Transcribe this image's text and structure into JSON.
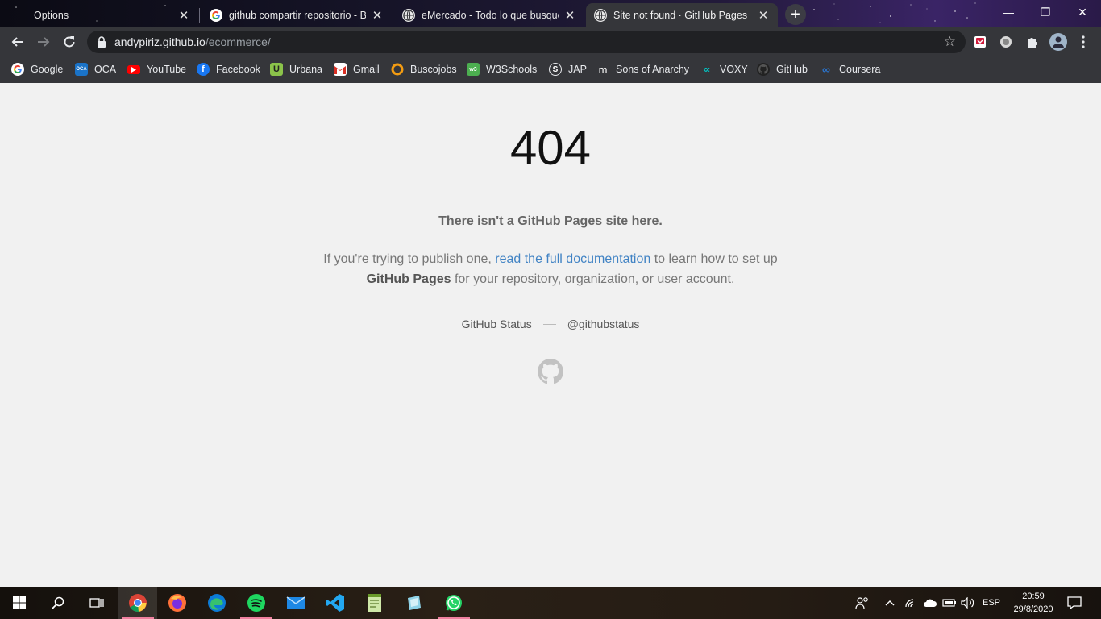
{
  "tabs": [
    {
      "title": "Options",
      "favicon": "blank-icon",
      "active": false
    },
    {
      "title": "github compartir repositorio - Bu",
      "favicon": "google-icon",
      "active": false
    },
    {
      "title": "eMercado - Todo lo que busques",
      "favicon": "globe-icon",
      "active": false
    },
    {
      "title": "Site not found · GitHub Pages",
      "favicon": "globe-icon",
      "active": true
    }
  ],
  "window_controls": {
    "minimize": "—",
    "restore": "❐",
    "close": "✕"
  },
  "toolbar": {
    "url_host": "andypiriz.github.io",
    "url_path": "/ecommerce/"
  },
  "bookmarks": [
    {
      "label": "Google",
      "icon": "google-icon"
    },
    {
      "label": "OCA",
      "icon": "oca-icon"
    },
    {
      "label": "YouTube",
      "icon": "youtube-icon"
    },
    {
      "label": "Facebook",
      "icon": "facebook-icon"
    },
    {
      "label": "Urbana",
      "icon": "urbana-icon"
    },
    {
      "label": "Gmail",
      "icon": "gmail-icon"
    },
    {
      "label": "Buscojobs",
      "icon": "buscojobs-icon"
    },
    {
      "label": "W3Schools",
      "icon": "w3schools-icon"
    },
    {
      "label": "JAP",
      "icon": "jap-icon"
    },
    {
      "label": "Sons of Anarchy",
      "icon": "netflix-m-icon"
    },
    {
      "label": "VOXY",
      "icon": "voxy-icon"
    },
    {
      "label": "GitHub",
      "icon": "github-icon"
    },
    {
      "label": "Coursera",
      "icon": "coursera-icon"
    }
  ],
  "page": {
    "code": "404",
    "headline": "There isn't a GitHub Pages site here.",
    "para_before": "If you're trying to publish one, ",
    "para_link": "read the full documentation",
    "para_middle": " to learn how to set up ",
    "para_bold": "GitHub Pages",
    "para_after": " for your repository, organization, or user account.",
    "status_link": "GitHub Status",
    "twitter_link": "@githubstatus"
  },
  "taskbar": {
    "apps": [
      "start-icon",
      "search-icon",
      "task-view-icon",
      "chrome-icon",
      "firefox-icon",
      "edge-icon",
      "spotify-icon",
      "mail-icon",
      "vscode-icon",
      "notepad-icon",
      "app-icon",
      "whatsapp-icon"
    ],
    "language": "ESP",
    "time": "20:59",
    "date": "29/8/2020"
  }
}
